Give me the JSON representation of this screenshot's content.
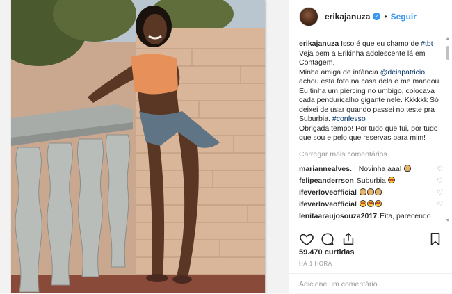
{
  "post": {
    "username": "erikajanuza",
    "follow_label": "Seguir",
    "separator": "•",
    "verified_mark": "✓",
    "caption": {
      "username": "erikajanuza",
      "line1_pre": "Isso é que eu chamo de ",
      "hashtag_tbt": "#tbt",
      "line2": "Veja bem a Erikinha adolescente lá em Contagem.",
      "line3_pre": "Minha amiga de infância ",
      "mention": "@deiapatricio",
      "line3_post": " achou esta foto na casa dela e me mandou. Eu tinha um piercing no umbigo, colocava cada penduricalho gigante nele. Kkkkkk Só deixei de usar quando passei no teste pra Suburbia. ",
      "hashtag_confesso": "#confesso",
      "line4": "Obrigada tempo! Por tudo que fui, por tudo que sou e pelo que reservas para mim!"
    },
    "load_more": "Carregar mais comentários",
    "comments": [
      {
        "user": "mariannealves._",
        "text": "Novinha aaa!",
        "emoji": [
          "hands"
        ]
      },
      {
        "user": "felipeanderrson",
        "text": "Suburbia",
        "emoji": [
          "eyes"
        ]
      },
      {
        "user": "ifeverloveofficial",
        "text": "",
        "emoji": [
          "hands",
          "hands",
          "hands"
        ]
      },
      {
        "user": "ifeverloveofficial",
        "text": "",
        "emoji": [
          "eyes",
          "eyes",
          "eyes"
        ]
      },
      {
        "user": "lenitaaraujosouza2017",
        "text": "Eita, parecendo",
        "emoji": []
      }
    ],
    "likes": "59.470 curtidas",
    "time": "HÁ 1 HORA",
    "add_comment_placeholder": "Adicione um comentário...",
    "icons": [
      "heart-icon",
      "comment-icon",
      "share-icon",
      "bookmark-icon"
    ],
    "colors": {
      "link": "#003569",
      "follow": "#3897f0",
      "muted": "#999999"
    }
  }
}
